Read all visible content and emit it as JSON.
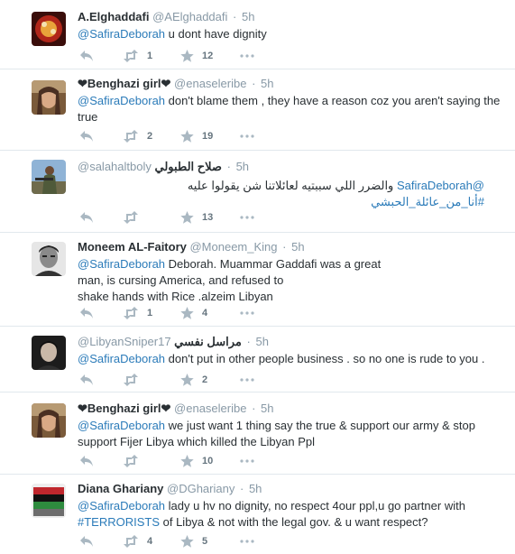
{
  "tweets": [
    {
      "name": "A.Elghaddafi",
      "handle": "@AElghaddafi",
      "time": "5h",
      "mention": "@SafiraDeborah",
      "text": " u dont have dignity",
      "retweets": "1",
      "favorites": "12",
      "avatar": "avatar-red-food"
    },
    {
      "name": "❤Benghazi girl❤",
      "handle": "@enaseleribe",
      "time": "5h",
      "mention": "@SafiraDeborah",
      "text": " don't blame them , they have a reason coz you aren't saying the true",
      "retweets": "2",
      "favorites": "19",
      "avatar": "avatar-woman-scarf"
    },
    {
      "name": "صلاح الطبولي",
      "handle": "@salahaltboly",
      "time": "5h",
      "mention": "@SafiraDeborah",
      "text": "والضرر اللي سببتيه لعائلاتنا شن يقولوا عليه",
      "hashtag": "#أنا_من_عائلة_الحبشي",
      "retweets": "",
      "favorites": "13",
      "avatar": "avatar-soldier"
    },
    {
      "name": "Moneem AL-Faitory",
      "handle": "@Moneem_King",
      "time": "5h",
      "mention": "@SafiraDeborah",
      "text_lines": [
        " Deborah. Muammar Gaddafi was a great",
        "man, is cursing America, and refused to",
        "shake hands with Rice .alzeim Libyan"
      ],
      "retweets": "1",
      "favorites": "4",
      "avatar": "avatar-man-bw"
    },
    {
      "name": "مراسل نفسي",
      "handle": "@LibyanSniper17",
      "time": "5h",
      "mention": "@SafiraDeborah",
      "text": " don't put in other people business . so no one is rude to you .",
      "retweets": "",
      "favorites": "2",
      "avatar": "avatar-man-dark"
    },
    {
      "name": "❤Benghazi girl❤",
      "handle": "@enaseleribe",
      "time": "5h",
      "mention": "@SafiraDeborah",
      "text": " we just want 1 thing say the true & support our army & stop support Fijer Libya which killed the Libyan Ppl",
      "retweets": "",
      "favorites": "10",
      "avatar": "avatar-woman-scarf"
    },
    {
      "name": "Diana Ghariany",
      "handle": "@DGhariany",
      "time": "5h",
      "mention": "@SafiraDeborah",
      "text": " lady u hv no dignity, no respect 4our ppl,u go partner with",
      "hashtag": "#TERRORISTS",
      "text2": " of Libya & not with the legal gov. & u want respect?",
      "retweets": "4",
      "favorites": "5",
      "avatar": "avatar-flag-photo"
    }
  ],
  "dot": "·",
  "colors": {
    "link": "#2b7bb9",
    "meta": "#8899a6",
    "divider": "#e1e8ed"
  }
}
